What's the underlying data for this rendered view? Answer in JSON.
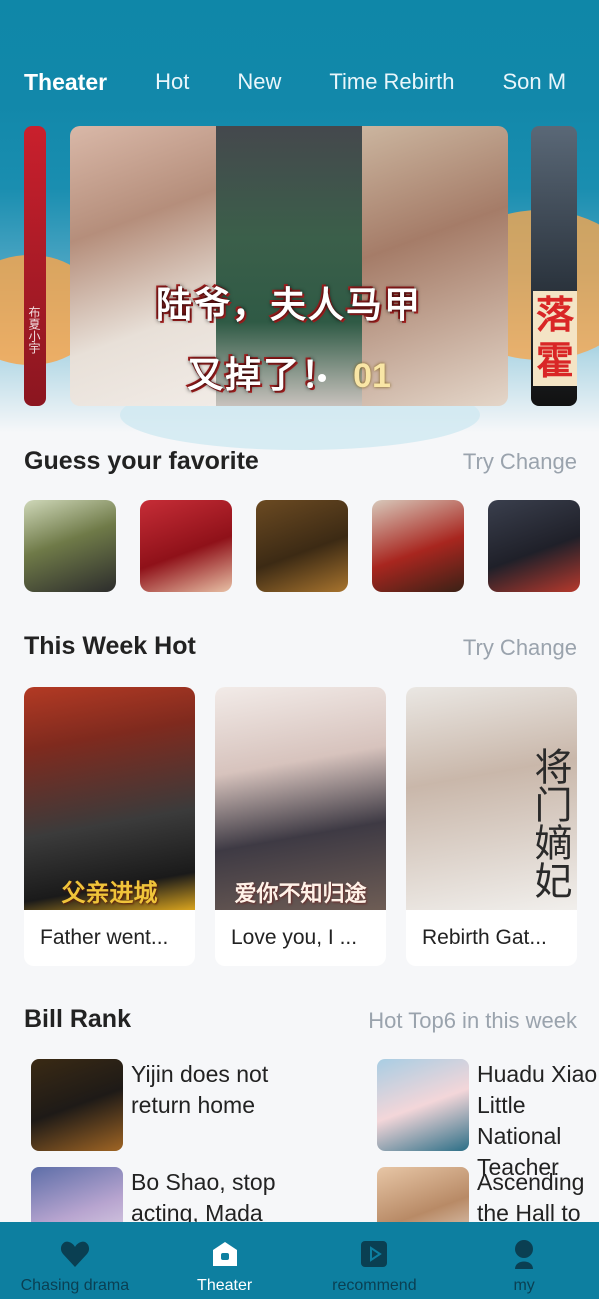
{
  "tabs": [
    {
      "label": "Theater",
      "active": true
    },
    {
      "label": "Hot",
      "active": false
    },
    {
      "label": "New",
      "active": false
    },
    {
      "label": "Time Rebirth",
      "active": false
    },
    {
      "label": "Son M",
      "active": false
    }
  ],
  "banner": {
    "title_line1": "陆爷，夫人马甲",
    "title_line2": "又掉了！",
    "episode": "01",
    "side_left_text": "布夏小宇",
    "side_right_text": "落霍"
  },
  "guess": {
    "title": "Guess your favorite",
    "action": "Try Change"
  },
  "week_hot": {
    "title": "This Week Hot",
    "action": "Try Change",
    "cards": [
      {
        "label": "Father went...",
        "poster_text": "父亲进城"
      },
      {
        "label": "Love you, I ...",
        "poster_text": "爱你不知归途"
      },
      {
        "label": "Rebirth Gat...",
        "poster_text": "将门嫡妃"
      }
    ]
  },
  "bill_rank": {
    "title": "Bill Rank",
    "subtitle": "Hot Top6 in this week",
    "items": [
      {
        "title": "Yijin does not return home"
      },
      {
        "title": "Huadu Xiao Little National Teacher"
      },
      {
        "title": "Bo Shao, stop acting, Mada"
      },
      {
        "title": "Ascending the Hall to"
      }
    ]
  },
  "nav": [
    {
      "label": "Chasing drama",
      "icon": "heart-icon",
      "active": false
    },
    {
      "label": "Theater",
      "icon": "home-icon",
      "active": true
    },
    {
      "label": "recommend",
      "icon": "play-icon",
      "active": false
    },
    {
      "label": "my",
      "icon": "user-icon",
      "active": false
    }
  ],
  "colors": {
    "primary": "#0d7fa0",
    "accent_orange": "#f5a64f"
  }
}
